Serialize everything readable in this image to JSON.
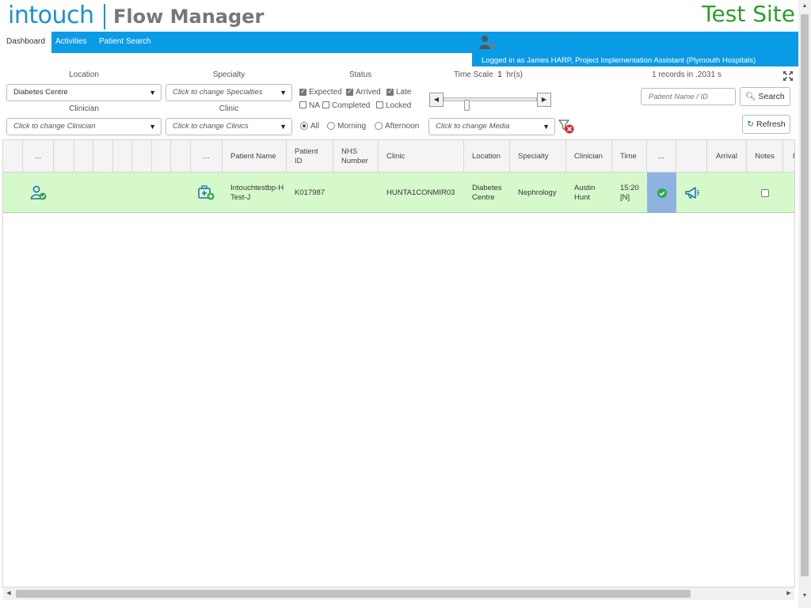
{
  "header": {
    "logo_brand": "intouch",
    "logo_product": "Flow Manager",
    "site_label": "Test Site"
  },
  "nav": {
    "tabs": [
      {
        "label": "Dashboard",
        "active": true
      },
      {
        "label": "Activities",
        "active": false
      },
      {
        "label": "Patient Search",
        "active": false
      }
    ],
    "logged_in_text": "Logged in as James HARP, Project Implementation Assistant (Plymouth Hospitals)"
  },
  "filters": {
    "location": {
      "label": "Location",
      "value": "Diabetes Centre"
    },
    "specialty": {
      "label": "Specialty",
      "placeholder": "Click to change Specialties"
    },
    "clinician": {
      "label": "Clinician",
      "placeholder": "Click to change Clinician"
    },
    "clinic": {
      "label": "Clinic",
      "placeholder": "Click to change Clinics"
    },
    "status": {
      "label": "Status",
      "options": [
        {
          "label": "Expected",
          "checked": true
        },
        {
          "label": "Arrived",
          "checked": true
        },
        {
          "label": "Late",
          "checked": true
        },
        {
          "label": "NA",
          "checked": false
        },
        {
          "label": "Completed",
          "checked": false
        },
        {
          "label": "Locked",
          "checked": false
        }
      ]
    },
    "session": {
      "options": [
        {
          "label": "All",
          "checked": true
        },
        {
          "label": "Morning",
          "checked": false
        },
        {
          "label": "Afternoon",
          "checked": false
        }
      ]
    },
    "timescale": {
      "label": "Time Scale",
      "value": "1",
      "unit": "hr(s)"
    },
    "media": {
      "placeholder": "Click to change Media"
    },
    "records_text": "1 records in .2031 s",
    "patient_input_placeholder": "Patient Name / ID",
    "search_label": "Search",
    "refresh_label": "Refresh"
  },
  "grid": {
    "columns": [
      "...",
      "...",
      "Patient Name",
      "Patient ID",
      "NHS Number",
      "Clinic",
      "Location",
      "Specialty",
      "Clinician",
      "Time",
      "...",
      "Arrival",
      "Notes",
      "F"
    ],
    "rows": [
      {
        "patient_name": "Intouchtestbp-H Test-J",
        "patient_id": "K017987",
        "nhs_number": "",
        "clinic": "HUNTA1CONMIR03",
        "location": "Diabetes Centre",
        "specialty": "Nephrology",
        "clinician": "Austin Hunt",
        "time": "15:20 [N]",
        "notes_checked": false
      }
    ]
  },
  "colors": {
    "brand_blue": "#0a9be6",
    "site_green": "#2b9e2b",
    "row_green": "#d6f9cc",
    "arrived_blue": "#8fb3e0"
  }
}
